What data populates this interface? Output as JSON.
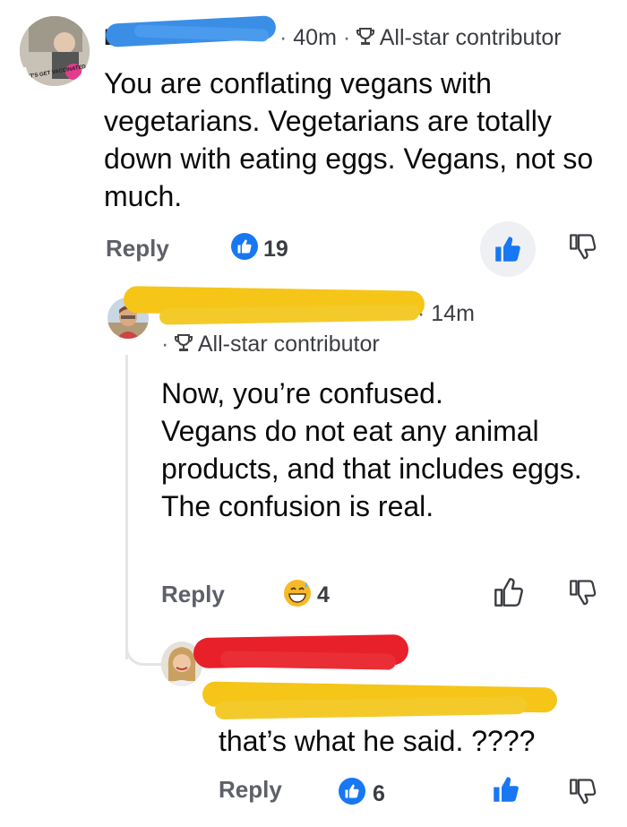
{
  "comments": [
    {
      "author": "D",
      "time": "40m",
      "badge": "All-star contributor",
      "avatar_text": "LET'S GET VACCINATED",
      "text": "You are conflating vegans with vegetarians. Vegetarians are totally down with eating eggs. Vegans, not so much.",
      "reply_label": "Reply",
      "reaction": "like-icon",
      "reaction_count": "19",
      "liked": true
    },
    {
      "author": "",
      "time": "14m",
      "badge": "All-star contributor",
      "text_lines": [
        "Now, you’re confused.",
        "Vegans do not eat any animal products, and that includes eggs.",
        "The confusion is real."
      ],
      "reply_label": "Reply",
      "reaction": "grin-sweat-emoji",
      "reaction_count": "4",
      "liked": false
    },
    {
      "author": "",
      "mention": "",
      "text": "that’s what he said. ????",
      "reply_label": "Reply",
      "reaction": "like-icon",
      "reaction_count": "6",
      "liked": true
    }
  ],
  "colors": {
    "brand_blue": "#1877f2",
    "scribble_blue": "#3a8ee6",
    "scribble_yellow": "#f5c518",
    "scribble_red": "#e8202a",
    "thread_line": "#e3e5e8"
  }
}
